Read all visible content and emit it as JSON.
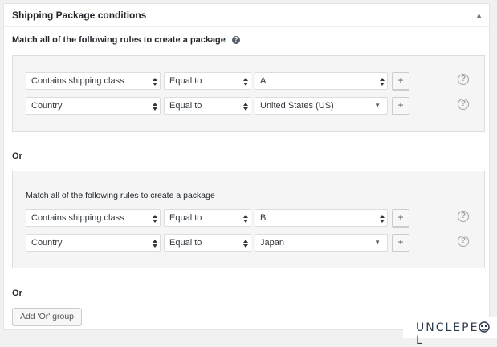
{
  "panel": {
    "title": "Shipping Package conditions",
    "toggle": "▲",
    "intro": "Match all of the following rules to create a package",
    "intro_help": "?"
  },
  "groups": [
    {
      "label": "",
      "rows": [
        {
          "condition": "Contains shipping class",
          "operator": "Equal to",
          "value": "A",
          "value_control": "arrows",
          "add": "+",
          "help": "?"
        },
        {
          "condition": "Country",
          "operator": "Equal to",
          "value": "United States (US)",
          "value_control": "caret",
          "add": "+",
          "help": "?"
        }
      ]
    },
    {
      "label": "Match all of the following rules to create a package",
      "rows": [
        {
          "condition": "Contains shipping class",
          "operator": "Equal to",
          "value": "B",
          "value_control": "arrows",
          "add": "+",
          "help": "?"
        },
        {
          "condition": "Country",
          "operator": "Equal to",
          "value": "Japan",
          "value_control": "caret",
          "add": "+",
          "help": "?"
        }
      ]
    }
  ],
  "or_labels": [
    "Or",
    "Or"
  ],
  "add_or_group_button": "Add 'Or' group",
  "watermark": {
    "text": "UNCLEPE",
    "text2": "L"
  },
  "colors": {
    "panel_bg": "#ffffff",
    "group_bg": "#f5f5f5",
    "page_bg": "#f1f1f1",
    "help_grey": "#a0a5aa"
  }
}
